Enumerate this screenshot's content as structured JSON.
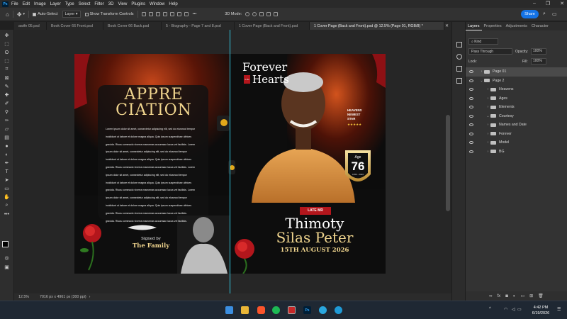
{
  "app": {
    "logo": "Ps"
  },
  "menu": [
    "File",
    "Edit",
    "Image",
    "Layer",
    "Type",
    "Select",
    "Filter",
    "3D",
    "View",
    "Plugins",
    "Window",
    "Help"
  ],
  "options": {
    "auto_select_label": "Auto-Select",
    "auto_select_value": "Layer",
    "transform_label": "Show Transform Controls",
    "mode_3d": "3D Mode:",
    "share_label": "Share"
  },
  "tabs": [
    "awife 05.psd",
    "Book Cover 66 Front.psd",
    "Book Cover 66 Back.psd",
    "5 - Biography - Page 7 and 8.psd",
    "1 Cover Page (Back and Front).psd",
    "1 Cover Page (Back and Front).psd @ 12.5% (Page 01, RGB/8) *"
  ],
  "status": {
    "zoom": "12.5%",
    "doc_size": "7016 px x 4961 px (300 ppi)"
  },
  "panel": {
    "tabs": [
      "Layers",
      "Properties",
      "Adjustments",
      "Character"
    ],
    "filter_kind": "Kind",
    "blend_mode": "Pass Through",
    "opacity_label": "Opacity:",
    "opacity_value": "100%",
    "lock_label": "Lock:",
    "fill_label": "Fill:",
    "fill_value": "100%",
    "layers": [
      {
        "name": "Page 01",
        "level": 0,
        "expanded": false,
        "selected": true
      },
      {
        "name": "Page 2",
        "level": 0,
        "expanded": true,
        "selected": false
      },
      {
        "name": "Heavens",
        "level": 1,
        "expanded": false,
        "selected": false
      },
      {
        "name": "Ages",
        "level": 1,
        "expanded": false,
        "selected": false
      },
      {
        "name": "Elements",
        "level": 1,
        "expanded": false,
        "selected": false
      },
      {
        "name": "Courtesy",
        "level": 1,
        "expanded": true,
        "selected": false
      },
      {
        "name": "Names and Date",
        "level": 1,
        "expanded": false,
        "selected": false
      },
      {
        "name": "Forever",
        "level": 1,
        "expanded": false,
        "selected": false
      },
      {
        "name": "Model",
        "level": 1,
        "expanded": false,
        "selected": false
      },
      {
        "name": "BG",
        "level": 1,
        "expanded": false,
        "selected": false
      }
    ]
  },
  "artwork": {
    "back": {
      "heading_line1": "APPRE",
      "heading_line2": "CIATION",
      "body_lines": [
        "Lorem ipsum dolor sit amet, consectetur adipiscing elit, sed do eiusmod tempor",
        "incididunt ut labore et dolore magna aliqua. Quis ipsum suspendisse ultrices",
        "gravida. Risus commodo viverra maecenas accumsan lacus vel facilisis. Lorem",
        "ipsum dolor sit amet, consectetur adipiscing elit, sed do eiusmod tempor",
        "incididunt ut labore et dolore magna aliqua. Quis ipsum suspendisse ultrices",
        "gravida. Risus commodo viverra maecenas accumsan lacus vel facilisis. Lorem",
        "ipsum dolor sit amet, consectetur adipiscing elit, sed do eiusmod tempor",
        "incididunt ut labore et dolore magna aliqua. Quis ipsum suspendisse ultrices",
        "gravida. Risus commodo viverra maecenas accumsan lacus vel facilisis. Lorem",
        "ipsum dolor sit amet, consectetur adipiscing elit, sed do eiusmod tempor",
        "incididunt ut labore et dolore magna aliqua. Quis ipsum suspendisse ultrices",
        "gravida. Risus commodo viverra maecenas accumsan lacus vel facilisis.",
        "gravida. Risus commodo viverra maecenas accumsan lacus vel facilisis."
      ],
      "signed_by": "Signed by",
      "family": "The Family"
    },
    "front": {
      "forever": "Forever",
      "in_the": "in the",
      "hearts": "Hearts",
      "heavens_lines": [
        "HEAVENS",
        "NEWEST",
        "STAR"
      ],
      "stars": "★★★★★",
      "age_label": "Age",
      "age_value": "76",
      "age_years": "1950 - 2026",
      "late_mr": "LATE MR",
      "first_name": "Thimoty",
      "last_name": "Silas Peter",
      "date": "15TH AUGUST 2026"
    }
  },
  "taskbar": {
    "time": "4:42 PM",
    "date": "6/19/2026"
  },
  "colors": {
    "accent": "#1473e6",
    "gold": "#e8c979",
    "red": "#b3161c",
    "guide": "#34c8e0"
  }
}
